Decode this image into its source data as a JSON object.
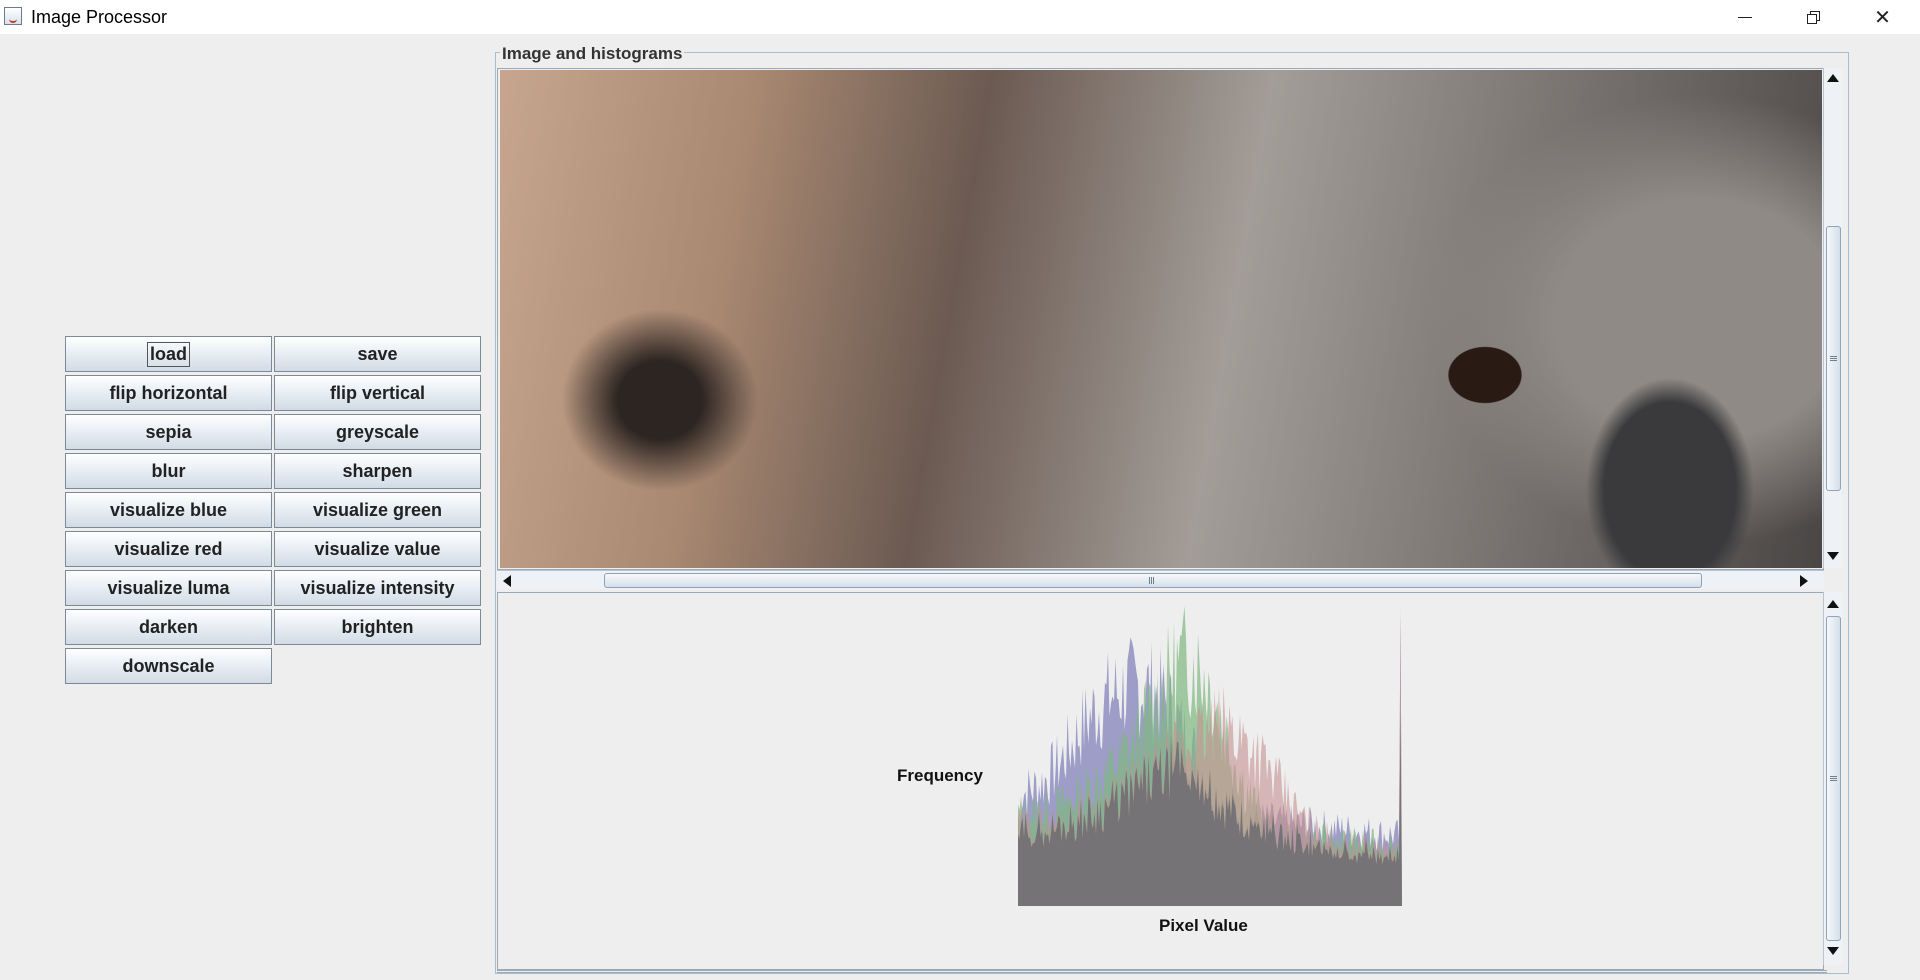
{
  "window": {
    "title": "Image Processor",
    "minimize_label": "",
    "restore_label": "",
    "close_label": "✕"
  },
  "buttons": [
    {
      "id": "load",
      "label": "load"
    },
    {
      "id": "save",
      "label": "save"
    },
    {
      "id": "flip-horizontal",
      "label": "flip horizontal"
    },
    {
      "id": "flip-vertical",
      "label": "flip vertical"
    },
    {
      "id": "sepia",
      "label": "sepia"
    },
    {
      "id": "greyscale",
      "label": "greyscale"
    },
    {
      "id": "blur",
      "label": "blur"
    },
    {
      "id": "sharpen",
      "label": "sharpen"
    },
    {
      "id": "visualize-blue",
      "label": "visualize blue"
    },
    {
      "id": "visualize-green",
      "label": "visualize green"
    },
    {
      "id": "visualize-red",
      "label": "visualize red"
    },
    {
      "id": "visualize-value",
      "label": "visualize value"
    },
    {
      "id": "visualize-luma",
      "label": "visualize luma"
    },
    {
      "id": "visualize-intensity",
      "label": "visualize intensity"
    },
    {
      "id": "darken",
      "label": "darken"
    },
    {
      "id": "brighten",
      "label": "brighten"
    },
    {
      "id": "downscale",
      "label": "downscale"
    }
  ],
  "panel": {
    "title": "Image and histograms"
  },
  "histogram": {
    "ylabel": "Frequency",
    "xlabel": "Pixel Value",
    "colors": {
      "blue": "#7a7ab8",
      "green": "#7fb87f",
      "red": "#c48f8f",
      "overlap": "#6f6f72"
    }
  },
  "icons": {
    "app": "java-coffee-icon",
    "scroll_up": "arrow-up-icon",
    "scroll_down": "arrow-down-icon",
    "scroll_left": "arrow-left-icon",
    "scroll_right": "arrow-right-icon"
  }
}
